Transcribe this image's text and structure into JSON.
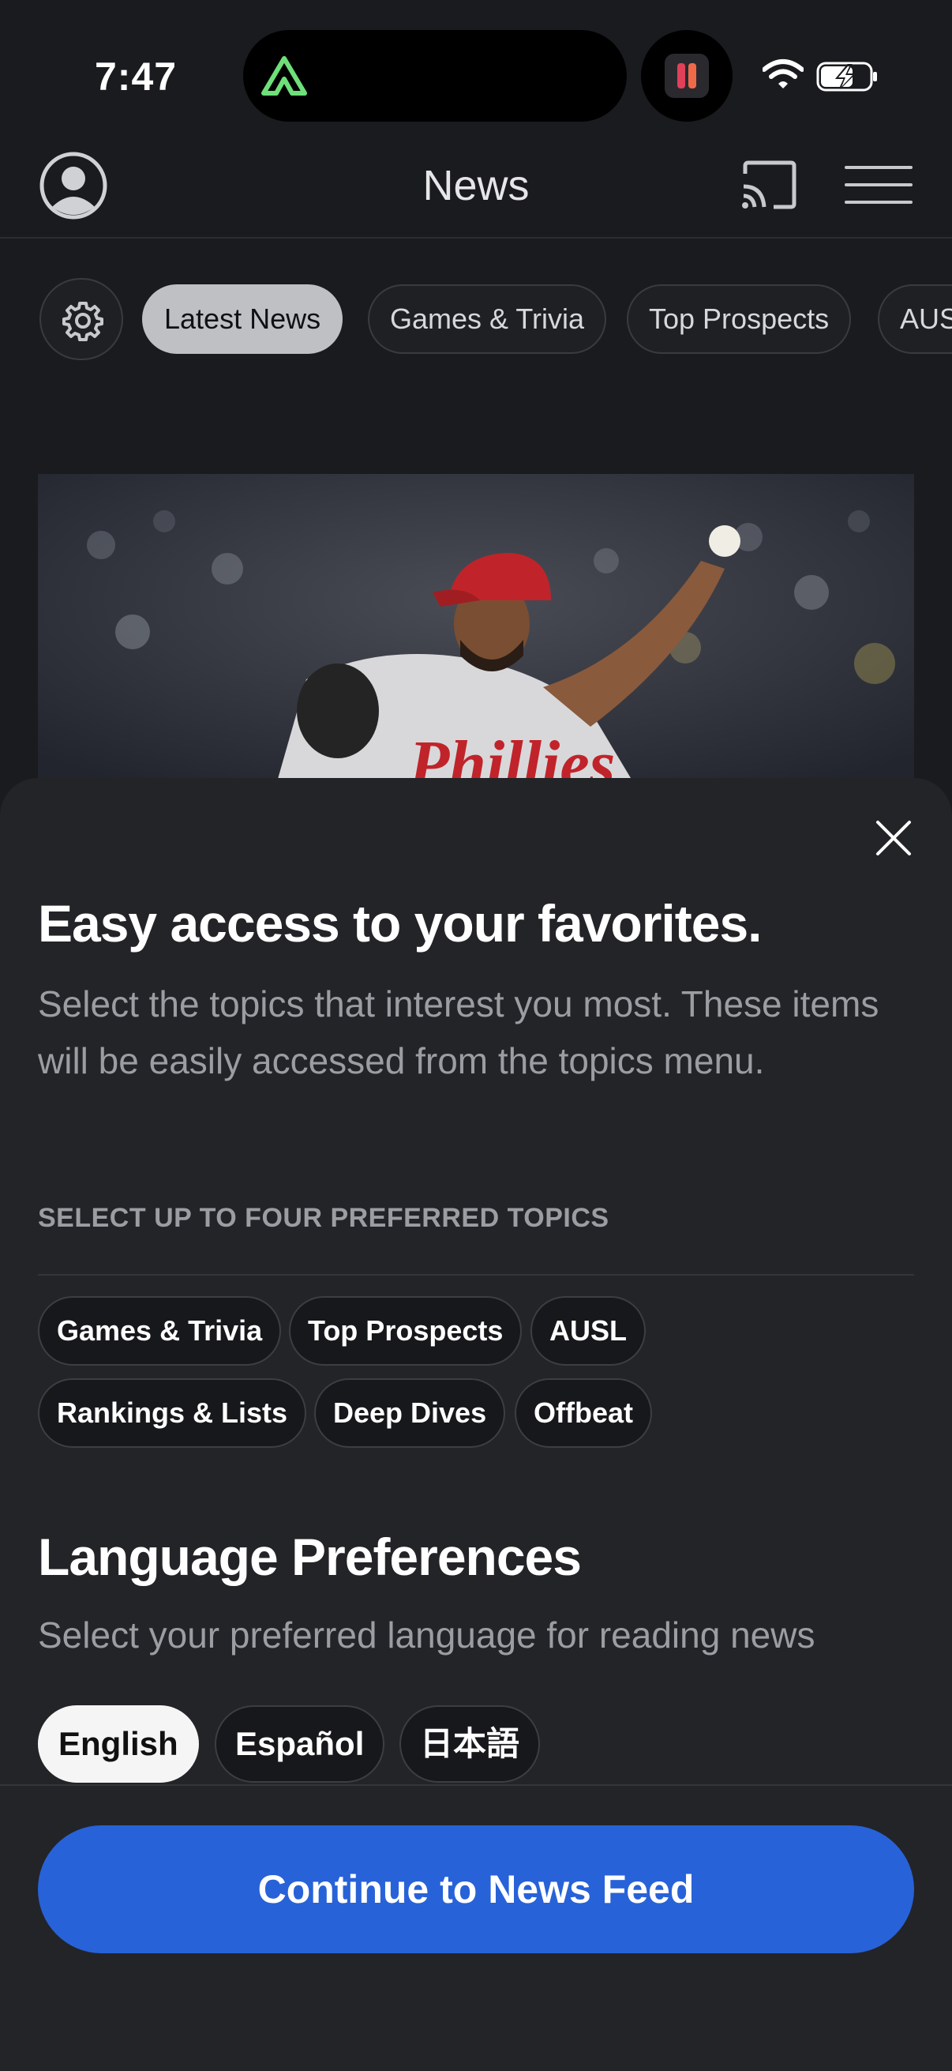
{
  "status_bar": {
    "time": "7:47"
  },
  "header": {
    "title": "News",
    "icons": [
      "profile-icon",
      "cast-icon",
      "menu-icon"
    ]
  },
  "category_chips": [
    {
      "label": "Latest News",
      "active": true
    },
    {
      "label": "Games & Trivia",
      "active": false
    },
    {
      "label": "Top Prospects",
      "active": false
    },
    {
      "label": "AUSL",
      "active": false
    }
  ],
  "sheet": {
    "title": "Easy access to your favorites.",
    "description": "Select the topics that interest you most. These items will be easily accessed from the topics menu.",
    "topics_label": "SELECT UP TO FOUR PREFERRED TOPICS",
    "topics": [
      "Games & Trivia",
      "Top Prospects",
      "AUSL",
      "Rankings & Lists",
      "Deep Dives",
      "Offbeat"
    ],
    "language_title": "Language Preferences",
    "language_description": "Select your preferred language for reading news",
    "languages": [
      {
        "label": "English",
        "selected": true
      },
      {
        "label": "Español",
        "selected": false
      },
      {
        "label": "日本語",
        "selected": false
      }
    ],
    "continue_label": "Continue to News Feed"
  },
  "colors": {
    "background": "#1a1b1f",
    "sheet": "#232427",
    "accent": "#2862d8",
    "app_icon_green": "#6ee07a"
  }
}
